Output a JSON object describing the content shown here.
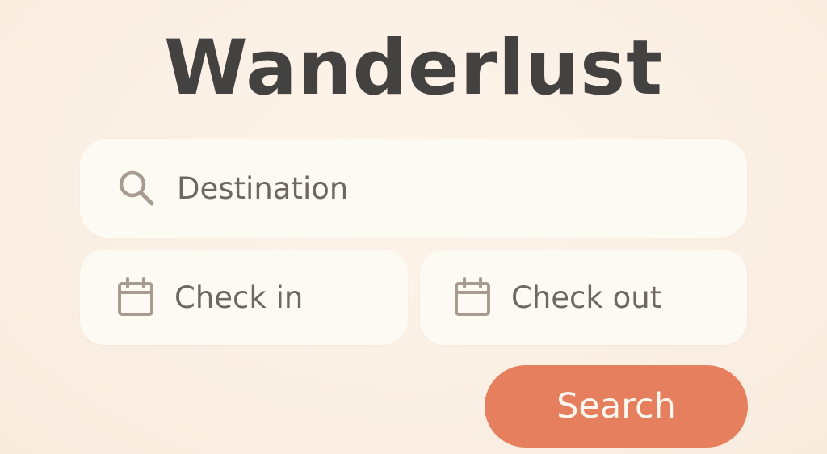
{
  "app": {
    "title": "Wanderlust"
  },
  "form": {
    "destination": {
      "placeholder": "Destination",
      "icon": "search-icon"
    },
    "check_in": {
      "placeholder": "Check in",
      "icon": "calendar-icon"
    },
    "check_out": {
      "placeholder": "Check out",
      "icon": "calendar-icon"
    },
    "search_label": "Search"
  },
  "colors": {
    "background": "#fbf0e5",
    "field": "#fdfaf4",
    "title": "#444240",
    "placeholder": "#6e6762",
    "icon": "#a79c92",
    "accent": "#e57f5e",
    "button_text": "#fdf6ef"
  }
}
